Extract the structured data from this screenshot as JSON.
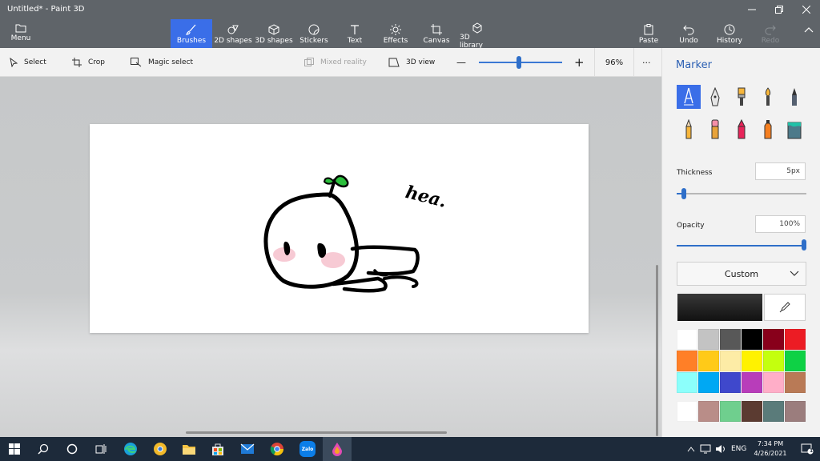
{
  "window": {
    "title": "Untitled* - Paint 3D",
    "controls": [
      "minimize-icon",
      "restore-icon",
      "close-icon"
    ]
  },
  "ribbon": {
    "menu_label": "Menu",
    "tools": [
      {
        "label": "Brushes",
        "icon": "brush-icon",
        "active": true
      },
      {
        "label": "2D shapes",
        "icon": "2d-shapes-icon"
      },
      {
        "label": "3D shapes",
        "icon": "3d-shapes-icon"
      },
      {
        "label": "Stickers",
        "icon": "stickers-icon"
      },
      {
        "label": "Text",
        "icon": "text-icon"
      },
      {
        "label": "Effects",
        "icon": "effects-icon"
      },
      {
        "label": "Canvas",
        "icon": "canvas-icon"
      },
      {
        "label": "3D library",
        "icon": "3d-library-icon"
      }
    ],
    "actions": [
      {
        "label": "Paste",
        "icon": "paste-icon"
      },
      {
        "label": "Undo",
        "icon": "undo-icon"
      },
      {
        "label": "History",
        "icon": "history-icon"
      },
      {
        "label": "Redo",
        "icon": "redo-icon",
        "disabled": true
      }
    ]
  },
  "toolbar": {
    "select": "Select",
    "crop": "Crop",
    "magic_select": "Magic select",
    "mixed_reality": "Mixed reality",
    "view_3d": "3D view",
    "zoom_minus": "—",
    "zoom_plus": "+",
    "zoom_value": "96%",
    "zoom_fraction": 0.5,
    "more": "···"
  },
  "canvas": {
    "handwriting": "hea."
  },
  "panel": {
    "title": "Marker",
    "brushes": [
      "marker-icon",
      "calligraphy-pen-icon",
      "oil-brush-icon",
      "watercolor-icon",
      "pixel-pen-icon",
      "pencil-icon",
      "eraser-icon",
      "crayon-icon",
      "spray-can-icon",
      "fill-icon"
    ],
    "thickness_label": "Thickness",
    "thickness_value": "5px",
    "thickness_fraction": 0.05,
    "opacity_label": "Opacity",
    "opacity_value": "100%",
    "opacity_fraction": 1.0,
    "color_mode": "Custom",
    "current_color": "#1e1e1e",
    "palette": [
      "#ffffff",
      "#c3c3c3",
      "#585858",
      "#000000",
      "#88001b",
      "#ec1c24",
      "#ff7f27",
      "#ffca18",
      "#fdeca6",
      "#fff200",
      "#c4ff0e",
      "#0ed145",
      "#8cfffb",
      "#00a8f3",
      "#3f48cc",
      "#b83dba",
      "#ffaec8",
      "#b97a56"
    ],
    "custom_colors": [
      "#ffffff",
      "#b98d88",
      "#6fcf8e",
      "#5b3b31",
      "#5a7b7a",
      "#9b7d7d"
    ]
  },
  "taskbar": {
    "apps": [
      "windows-start-icon",
      "search-icon",
      "cortana-icon",
      "task-view-icon",
      "edge-icon",
      "chrome-canary-icon",
      "file-explorer-icon",
      "store-icon",
      "mail-icon",
      "chrome-icon",
      "zalo-icon",
      "paint-3d-icon"
    ],
    "zalo_label": "Zalo",
    "language": "ENG",
    "time": "7:34 PM",
    "date": "4/26/2021",
    "notification_count": "1"
  }
}
